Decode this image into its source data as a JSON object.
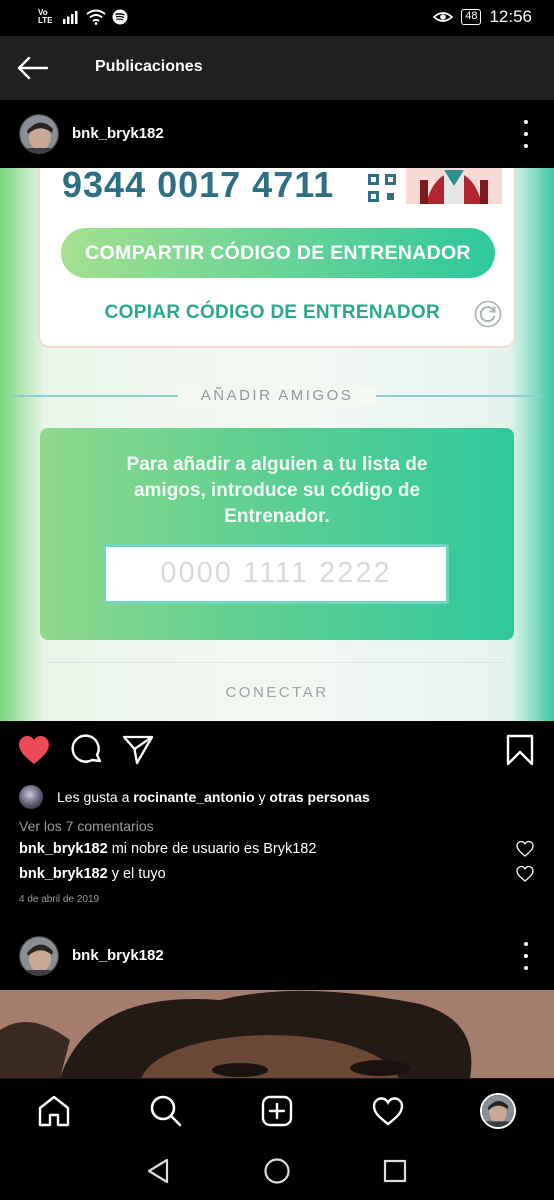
{
  "status_bar": {
    "volte_top": "Vo",
    "volte_bottom": "LTE",
    "battery": "48",
    "time": "12:56"
  },
  "app_bar": {
    "title": "Publicaciones"
  },
  "post": {
    "username": "bnk_bryk182",
    "image": {
      "trainer_code": "9344 0017 4711",
      "share_button": "COMPARTIR CÓDIGO DE ENTRENADOR",
      "copy_button": "COPIAR CÓDIGO DE ENTRENADOR",
      "add_friends_label": "AÑADIR AMIGOS",
      "add_friends_text": "Para añadir a alguien a tu lista de amigos, introduce su código de Entrenador.",
      "code_placeholder": "0000 1111 2222",
      "connect_label": "CONECTAR"
    },
    "likes": {
      "prefix": "Les gusta a ",
      "user": "rocinante_antonio",
      "connector": " y ",
      "others": "otras personas"
    },
    "view_comments": "Ver los 7 comentarios",
    "comments": [
      {
        "user": "bnk_bryk182",
        "text": " mi nobre de usuario es Bryk182"
      },
      {
        "user": "bnk_bryk182",
        "text": " y el tuyo"
      }
    ],
    "date": "4 de abril de 2019"
  },
  "next_post": {
    "username": "bnk_bryk182"
  },
  "icons": {
    "like": "heart-filled-icon",
    "comment": "comment-icon",
    "share": "send-icon",
    "save": "bookmark-icon",
    "nav_home": "home-icon",
    "nav_search": "search-icon",
    "nav_add": "add-post-icon",
    "nav_activity": "heart-outline-icon"
  },
  "colors": {
    "like": "#ed4956",
    "background": "#000000",
    "app_bar": "#202020"
  }
}
